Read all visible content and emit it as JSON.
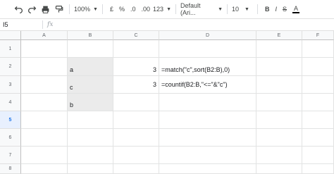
{
  "toolbar": {
    "zoom": "100%",
    "currency": "£",
    "percent": "%",
    "decrease_decimals": ".0",
    "increase_decimals": ".00",
    "more_formats": "123",
    "font": "Default (Ari...",
    "font_size": "10",
    "bold": "B",
    "italic": "I",
    "strikethrough": "S",
    "text_color": "A"
  },
  "formula_bar": {
    "name_box": "I5",
    "fx": "fx",
    "value": ""
  },
  "columns": [
    "A",
    "B",
    "C",
    "D",
    "E",
    "F"
  ],
  "rows": [
    "1",
    "2",
    "3",
    "4",
    "5",
    "6",
    "7",
    "8"
  ],
  "cells": {
    "b2": "a",
    "b3": "c",
    "b4": "b",
    "c2": "3",
    "c3": "3",
    "d2": "=match(\"c\",sort(B2:B),0)",
    "d3": "=countif(B2:B,\"<=\"&\"c\")"
  },
  "colors": {
    "shaded_cell": "#ebebeb",
    "active_row_header": "#e8f0fe",
    "active_row_text": "#1a73e8"
  }
}
